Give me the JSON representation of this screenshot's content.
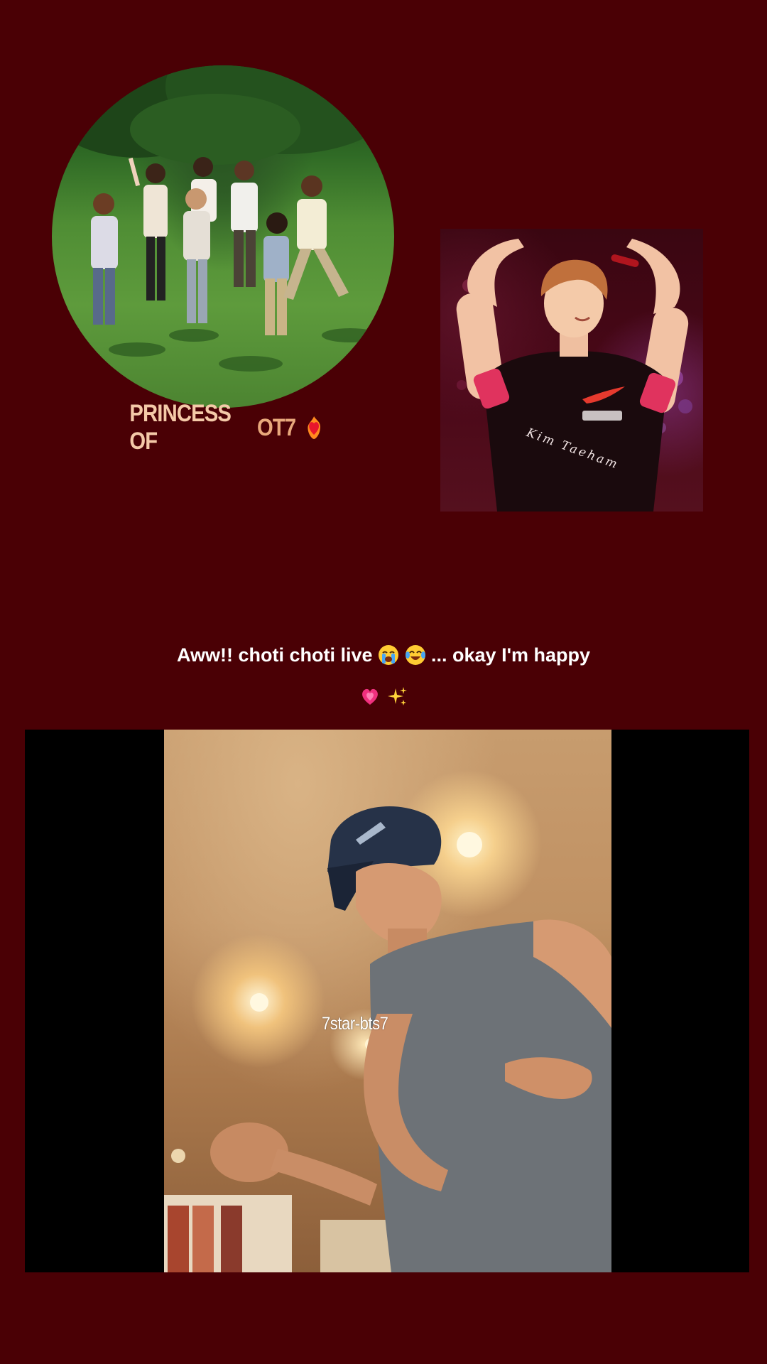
{
  "stage": {
    "background": "#4a0005"
  },
  "group_photo": {
    "caption_part1": "PRINCESS OF ",
    "caption_part2": "OT7",
    "caption_emoji": "heart-on-fire-emoji"
  },
  "concert_photo": {
    "signature": "Kim Taeham"
  },
  "post": {
    "caption_text": "Aww!! choti choti live",
    "caption_emoji1": "loudly-crying-face-emoji",
    "caption_emoji2": "tears-of-joy-emoji",
    "caption_text2": "... okay I'm happy",
    "caption_emoji3": "growing-heart-emoji",
    "caption_emoji4": "sparkles-emoji"
  },
  "video": {
    "watermark": "7star-bts7"
  }
}
